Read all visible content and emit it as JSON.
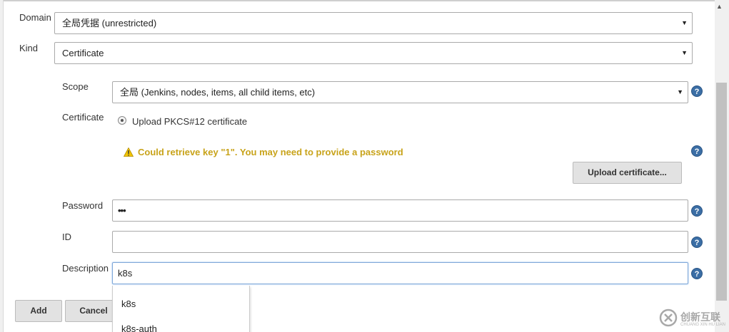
{
  "form": {
    "domain": {
      "label": "Domain",
      "value": "全局凭据 (unrestricted)"
    },
    "kind": {
      "label": "Kind",
      "value": "Certificate"
    },
    "scope": {
      "label": "Scope",
      "value": "全局 (Jenkins, nodes, items, all child items, etc)"
    },
    "certificate": {
      "label": "Certificate",
      "option_label": "Upload PKCS#12 certificate",
      "warning": "Could retrieve key \"1\". You may need to provide a password",
      "upload_button": "Upload certificate..."
    },
    "password": {
      "label": "Password",
      "value": "•••"
    },
    "id": {
      "label": "ID",
      "value": ""
    },
    "description": {
      "label": "Description",
      "value": "k8s"
    }
  },
  "autocomplete": {
    "options": [
      "k8s",
      "k8s-auth"
    ]
  },
  "actions": {
    "add_label": "Add",
    "cancel_label": "Cancel"
  },
  "help_icon_glyph": "?",
  "watermark": {
    "brand": "创新互联",
    "sub": "CHUANG XIN HU LIAN"
  },
  "colors": {
    "warning": "#c8a31a",
    "help": "#3b6ea5",
    "focus_border": "#7ea7d8"
  },
  "icons": {
    "help": "question-circle-icon",
    "warning": "warning-triangle-icon",
    "select_arrow": "triangle-down-icon"
  }
}
